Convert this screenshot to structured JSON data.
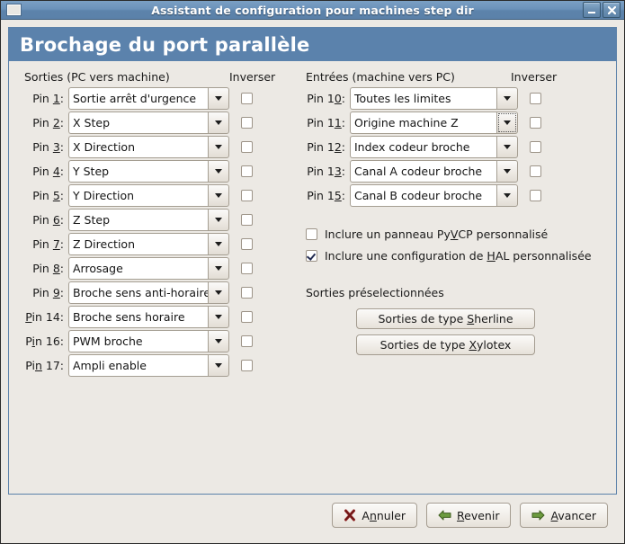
{
  "window": {
    "title": "Assistant de configuration pour machines step dir",
    "menu_icon": "window-menu-icon",
    "minimize_label": "_",
    "close_label": "✕"
  },
  "banner": {
    "title": "Brochage du port parallèle"
  },
  "outputs": {
    "group_label_pre": "Sorties (PC vers machine)",
    "group_label": "Sorties (PC vers machine)",
    "inverser_label": "Inverser",
    "rows": [
      {
        "pin_pre": "Pin ",
        "pin_mnemonic": "1",
        "pin_post": ":",
        "value": "Sortie arrêt d'urgence",
        "inverted": false
      },
      {
        "pin_pre": "Pin ",
        "pin_mnemonic": "2",
        "pin_post": ":",
        "value": "X Step",
        "inverted": false
      },
      {
        "pin_pre": "Pin ",
        "pin_mnemonic": "3",
        "pin_post": ":",
        "value": "X Direction",
        "inverted": false
      },
      {
        "pin_pre": "Pin ",
        "pin_mnemonic": "4",
        "pin_post": ":",
        "value": "Y Step",
        "inverted": false
      },
      {
        "pin_pre": "Pin ",
        "pin_mnemonic": "5",
        "pin_post": ":",
        "value": "Y Direction",
        "inverted": false
      },
      {
        "pin_pre": "Pin ",
        "pin_mnemonic": "6",
        "pin_post": ":",
        "value": "Z Step",
        "inverted": false
      },
      {
        "pin_pre": "Pin ",
        "pin_mnemonic": "7",
        "pin_post": ":",
        "value": "Z Direction",
        "inverted": false
      },
      {
        "pin_pre": "Pin ",
        "pin_mnemonic": "8",
        "pin_post": ":",
        "value": "Arrosage",
        "inverted": false
      },
      {
        "pin_pre": "Pin ",
        "pin_mnemonic": "9",
        "pin_post": ":",
        "value": "Broche sens anti-horaire",
        "inverted": false
      },
      {
        "pin_pre": "",
        "pin_mnemonic": "P",
        "pin_post": "in 14:",
        "value": "Broche sens horaire",
        "inverted": false
      },
      {
        "pin_pre": "P",
        "pin_mnemonic": "i",
        "pin_post": "n 16:",
        "value": "PWM broche",
        "inverted": false
      },
      {
        "pin_pre": "Pi",
        "pin_mnemonic": "n",
        "pin_post": " 17:",
        "value": "Ampli enable",
        "inverted": false
      }
    ]
  },
  "inputs": {
    "group_label": "Entrées (machine vers PC)",
    "inverser_label": "Inverser",
    "rows": [
      {
        "pin_pre": "Pin 1",
        "pin_mnemonic": "0",
        "pin_post": ":",
        "value": "Toutes les limites",
        "inverted": false,
        "focused": false
      },
      {
        "pin_pre": "Pin 1",
        "pin_mnemonic": "1",
        "pin_post": ":",
        "value": "Origine machine Z",
        "inverted": false,
        "focused": true
      },
      {
        "pin_pre": "Pin 1",
        "pin_mnemonic": "2",
        "pin_post": ":",
        "value": "Index codeur broche",
        "inverted": false,
        "focused": false
      },
      {
        "pin_pre": "Pin 1",
        "pin_mnemonic": "3",
        "pin_post": ":",
        "value": "Canal A codeur broche",
        "inverted": false,
        "focused": false
      },
      {
        "pin_pre": "Pin 1",
        "pin_mnemonic": "5",
        "pin_post": ":",
        "value": "Canal B codeur broche",
        "inverted": false,
        "focused": false
      }
    ]
  },
  "options": [
    {
      "pre": "Inclure un panneau Py",
      "mnemonic": "V",
      "post": "CP personnalisé",
      "checked": false
    },
    {
      "pre": "Inclure une configuration de ",
      "mnemonic": "H",
      "post": "AL personnalisée",
      "checked": true
    }
  ],
  "presets": {
    "section_title": "Sorties préselectionnées",
    "buttons": [
      {
        "pre": "Sorties de type ",
        "mnemonic": "S",
        "post": "herline"
      },
      {
        "pre": "Sorties de type ",
        "mnemonic": "X",
        "post": "ylotex"
      }
    ]
  },
  "footer": {
    "buttons": [
      {
        "icon": "cancel-x-icon",
        "pre": "A",
        "mnemonic": "n",
        "post": "nuler"
      },
      {
        "icon": "arrow-left-icon",
        "pre": "",
        "mnemonic": "R",
        "post": "evenir"
      },
      {
        "icon": "arrow-right-icon",
        "pre": "",
        "mnemonic": "A",
        "post": "vancer"
      }
    ]
  },
  "colors": {
    "titlebar": "#5b81a9",
    "banner": "#5b82ac",
    "window_bg": "#ece9e4",
    "panel_border": "#5b81a9",
    "check_mark": "#242d52",
    "arrow_green": "#6d9b3f",
    "cancel_red": "#8f2020"
  }
}
